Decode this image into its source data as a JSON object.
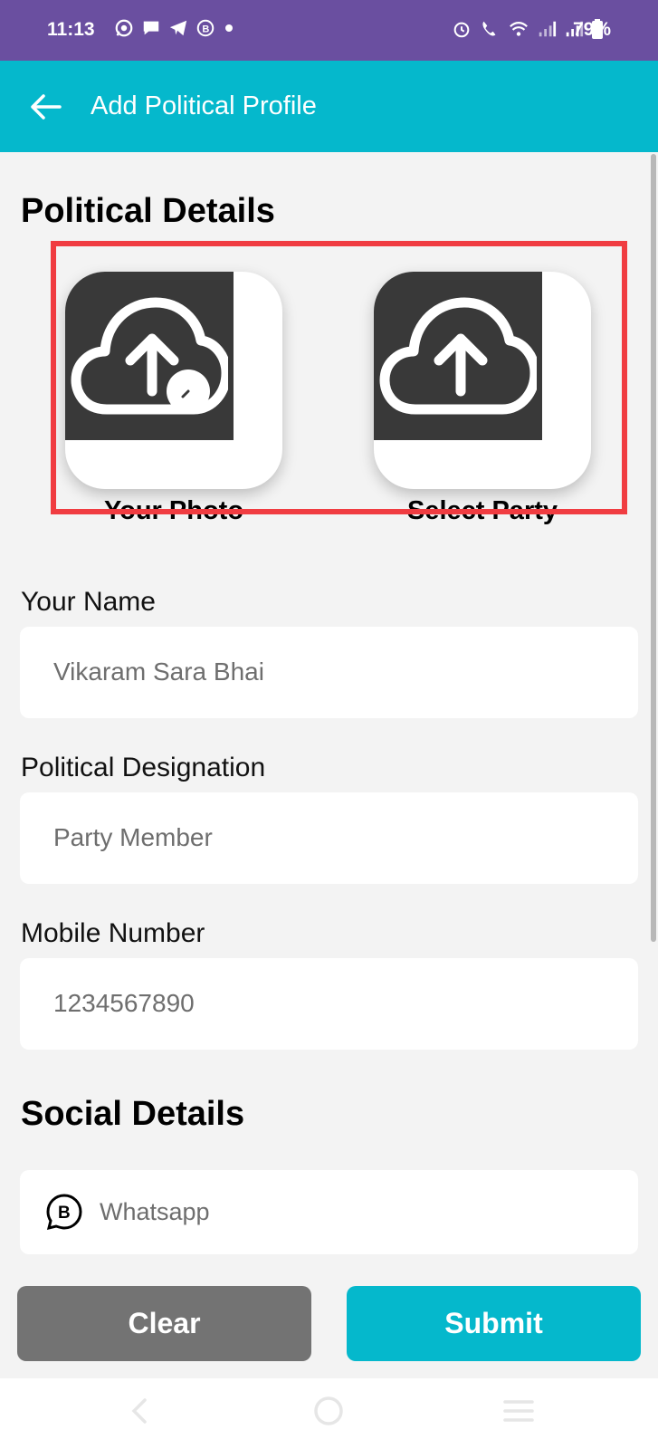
{
  "status_bar": {
    "time": "11:13",
    "battery": "79%",
    "left_icons": [
      "whatsapp-icon",
      "message-icon",
      "telegram-icon",
      "business-icon",
      "dot-icon"
    ],
    "right_icons": [
      "alarm-icon",
      "wifi-call-icon",
      "wifi-icon",
      "signal-icon",
      "signal-icon",
      "battery-icon"
    ]
  },
  "app_bar": {
    "title": "Add Political Profile",
    "back_icon": "back-arrow-icon"
  },
  "political": {
    "heading": "Political Details",
    "uploads": [
      {
        "label": "Your Photo",
        "icon": "cloud-upload-icon"
      },
      {
        "label": "Select Party",
        "icon": "cloud-upload-icon"
      }
    ]
  },
  "fields": [
    {
      "label": "Your Name",
      "value": "Vikaram Sara Bhai"
    },
    {
      "label": "Political Designation",
      "value": "Party Member"
    },
    {
      "label": "Mobile Number",
      "value": "1234567890"
    }
  ],
  "social": {
    "heading": "Social Details",
    "whatsapp_placeholder": "Whatsapp"
  },
  "buttons": {
    "clear": "Clear",
    "submit": "Submit"
  },
  "colors": {
    "status_bar": "#6a4fa0",
    "accent": "#05b8cc",
    "clear_button": "#737373",
    "highlight": "#f03c41"
  }
}
